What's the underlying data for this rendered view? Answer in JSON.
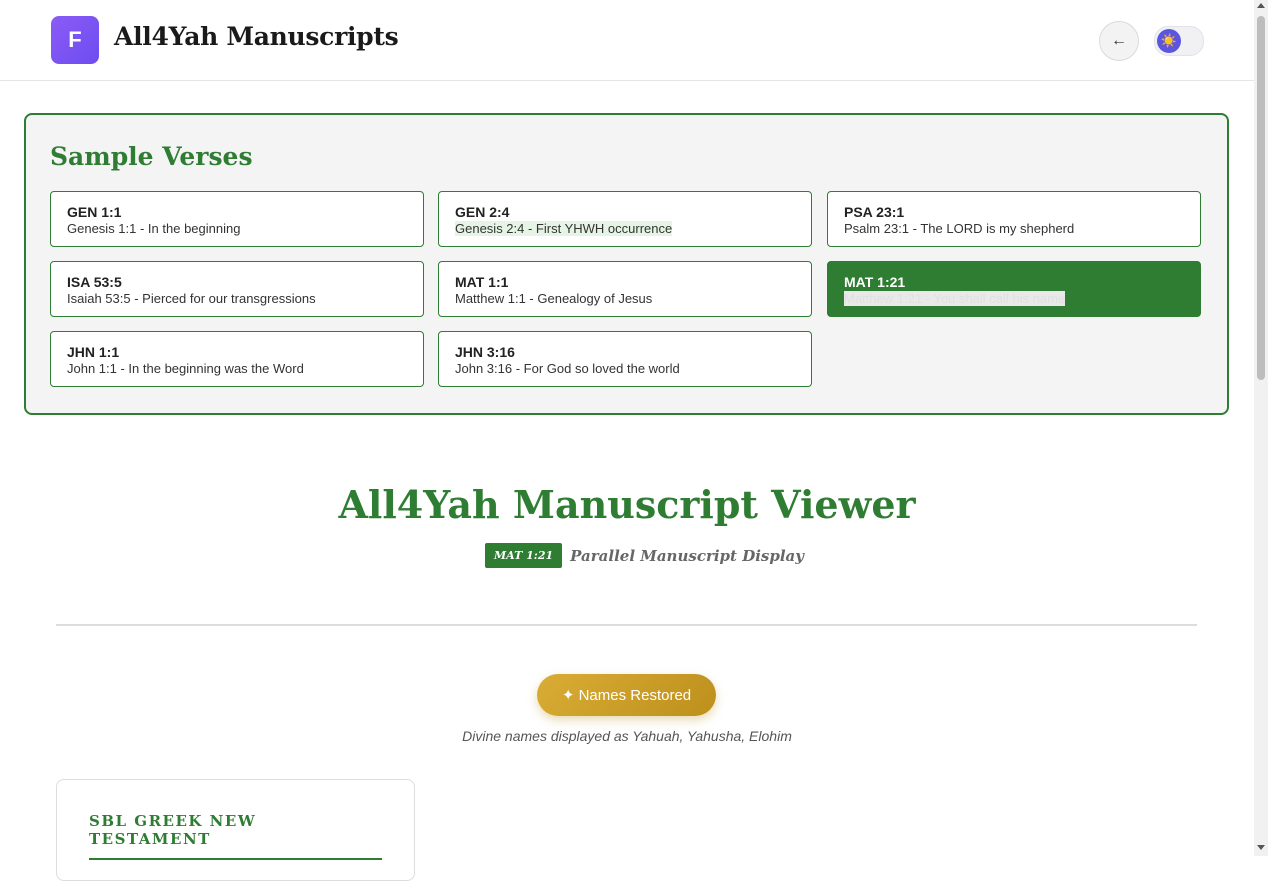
{
  "header": {
    "logo_letter": "F",
    "app_title": "All4Yah Manuscripts",
    "back_label": "←",
    "theme_icon": "☀️"
  },
  "samples": {
    "title": "Sample Verses",
    "verses": [
      {
        "ref": "GEN 1:1",
        "desc": "Genesis 1:1 - In the beginning"
      },
      {
        "ref": "GEN 2:4",
        "desc": "Genesis 2:4 - First YHWH occurrence"
      },
      {
        "ref": "PSA 23:1",
        "desc": "Psalm 23:1 - The LORD is my shepherd"
      },
      {
        "ref": "ISA 53:5",
        "desc": "Isaiah 53:5 - Pierced for our transgressions"
      },
      {
        "ref": "MAT 1:1",
        "desc": "Matthew 1:1 - Genealogy of Jesus"
      },
      {
        "ref": "MAT 1:21",
        "desc": "Matthew 1:21 - You shall call his name"
      },
      {
        "ref": "JHN 1:1",
        "desc": "John 1:1 - In the beginning was the Word"
      },
      {
        "ref": "JHN 3:16",
        "desc": "John 3:16 - For God so loved the world"
      }
    ],
    "active_ref": "MAT 1:21"
  },
  "viewer": {
    "title": "All4Yah Manuscript Viewer",
    "ref_badge": "MAT 1:21",
    "subtitle": "Parallel Manuscript Display"
  },
  "names": {
    "button_label": "✦ Names Restored",
    "note": "Divine names displayed as Yahuah, Yahusha, Elohim"
  },
  "manuscript": {
    "title": "SBL GREEK NEW TESTAMENT"
  },
  "colors": {
    "accent_green": "#2e7d32",
    "gold": "#c9a02a",
    "logo_purple": "#7c5cf2"
  }
}
